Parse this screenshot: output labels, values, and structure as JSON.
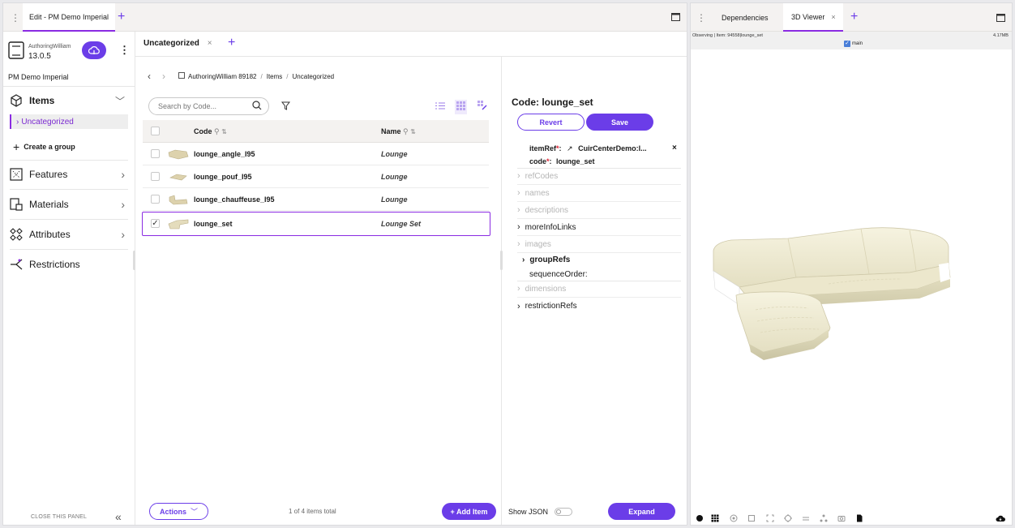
{
  "left_window": {
    "tab_title": "Edit - PM Demo Imperial",
    "user": {
      "name": "AuthoringWilliam",
      "version": "13.0.5"
    },
    "project_name": "PM Demo Imperial",
    "nav": [
      {
        "label": "Items",
        "icon": "cube-icon"
      },
      {
        "label": "Features",
        "icon": "features-icon"
      },
      {
        "label": "Materials",
        "icon": "materials-icon"
      },
      {
        "label": "Attributes",
        "icon": "attributes-icon"
      },
      {
        "label": "Restrictions",
        "icon": "restrictions-icon"
      }
    ],
    "items_sub": {
      "selected": "Uncategorized",
      "create_group": "Create a group"
    },
    "close_panel": "CLOSE THIS PANEL",
    "content_tab": "Uncategorized",
    "breadcrumb": [
      "AuthoringWilliam 89182",
      "Items",
      "Uncategorized"
    ],
    "search": {
      "placeholder": "Search by Code..."
    },
    "table": {
      "headers": {
        "code": "Code",
        "name": "Name"
      },
      "rows": [
        {
          "code": "lounge_angle_I95",
          "name": "Lounge",
          "checked": false
        },
        {
          "code": "lounge_pouf_I95",
          "name": "Lounge",
          "checked": false
        },
        {
          "code": "lounge_chauffeuse_I95",
          "name": "Lounge",
          "checked": false
        },
        {
          "code": "lounge_set",
          "name": "Lounge Set",
          "checked": true
        }
      ]
    },
    "footer": {
      "actions": "Actions",
      "count": "1 of 4 items total",
      "add_item": "+ Add Item"
    },
    "detail": {
      "title": "Code: lounge_set",
      "revert": "Revert",
      "save": "Save",
      "item_ref_label": "itemRef",
      "item_ref_value": "CuirCenterDemo:l...",
      "code_label": "code",
      "code_value": "lounge_set",
      "required_mark": "*",
      "colon": ":",
      "close_x": "×",
      "properties": [
        {
          "label": "refCodes",
          "enabled": false,
          "expandable": true
        },
        {
          "label": "names",
          "enabled": false,
          "expandable": true
        },
        {
          "label": "descriptions",
          "enabled": false,
          "expandable": true
        },
        {
          "label": "moreInfoLinks",
          "enabled": true,
          "expandable": true
        },
        {
          "label": "images",
          "enabled": false,
          "expandable": true
        },
        {
          "label": "groupRefs",
          "enabled": true,
          "expandable": true,
          "bold": true
        },
        {
          "label": "sequenceOrder:",
          "enabled": true,
          "expandable": false
        },
        {
          "label": "dimensions",
          "enabled": false,
          "expandable": true
        },
        {
          "label": "restrictionRefs",
          "enabled": true,
          "expandable": true
        }
      ],
      "show_json": "Show JSON",
      "expand": "Expand"
    }
  },
  "right_window": {
    "tabs": [
      "Dependencies",
      "3D Viewer"
    ],
    "observing": "Observing | Item: 94558|lounge_set",
    "size": "4.17MB",
    "branch": "main"
  },
  "colors": {
    "accent": "#6b3de8",
    "highlight": "#8a2be2",
    "sofa": "#f2eed5"
  }
}
